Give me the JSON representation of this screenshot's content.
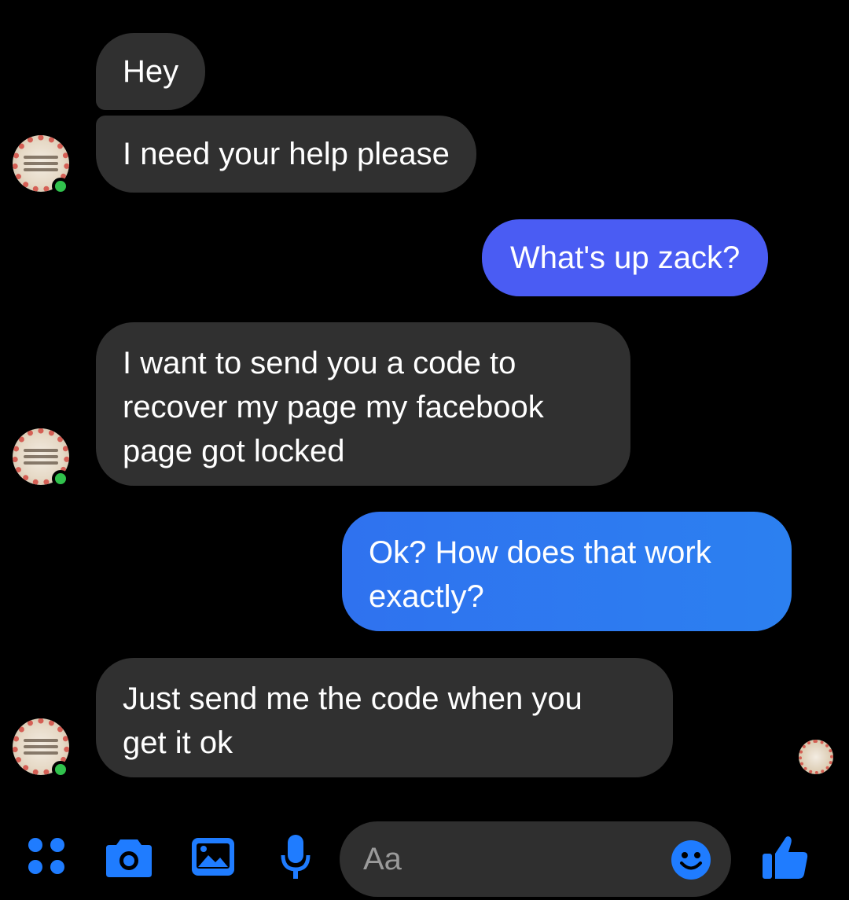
{
  "messages": [
    {
      "side": "incoming",
      "text": "Hey"
    },
    {
      "side": "incoming",
      "text": "I need your help please"
    },
    {
      "side": "outgoing",
      "text": "What's up zack?"
    },
    {
      "side": "incoming",
      "text": "I want to send you a code to\nrecover my page my facebook\npage got locked"
    },
    {
      "side": "outgoing",
      "text": "Ok?  How does that work\nexactly?"
    },
    {
      "side": "incoming",
      "text": "Just send me the code when you\nget it ok"
    }
  ],
  "composer": {
    "placeholder": "Aa",
    "icons": [
      "menu-dots-icon",
      "camera-icon",
      "gallery-icon",
      "microphone-icon",
      "emoji-icon",
      "thumbs-up-icon"
    ]
  },
  "colors": {
    "background": "#000000",
    "incoming_bubble": "#303030",
    "outgoing_bubble": "#3a6ef5",
    "accent": "#1f7cff",
    "online": "#31c24d"
  }
}
